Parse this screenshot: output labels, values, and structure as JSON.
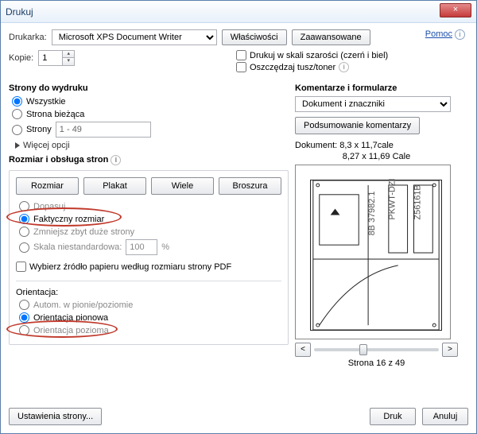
{
  "window": {
    "title": "Drukuj",
    "close": "×"
  },
  "help": {
    "label": "Pomoc"
  },
  "printer": {
    "label": "Drukarka:",
    "value": "Microsoft XPS Document Writer",
    "properties_btn": "Właściwości",
    "advanced_btn": "Zaawansowane"
  },
  "copies": {
    "label": "Kopie:",
    "value": "1"
  },
  "options": {
    "grayscale": "Drukuj w skali szarości (czerń i biel)",
    "save_ink": "Oszczędzaj tusz/toner"
  },
  "pages": {
    "title": "Strony do wydruku",
    "all": "Wszystkie",
    "current": "Strona bieżąca",
    "range_label": "Strony",
    "range_value": "1 - 49",
    "more": "Więcej opcji"
  },
  "size": {
    "title": "Rozmiar i obsługa stron",
    "btn_size": "Rozmiar",
    "btn_poster": "Plakat",
    "btn_multi": "Wiele",
    "btn_booklet": "Broszura",
    "fit": "Dopasuj",
    "actual": "Faktyczny rozmiar",
    "shrink": "Zmniejsz zbyt duże strony",
    "custom_label": "Skala niestandardowa:",
    "custom_value": "100",
    "percent": "%",
    "paper_source": "Wybierz źródło papieru według rozmiaru strony PDF"
  },
  "orientation": {
    "title": "Orientacja:",
    "auto": "Autom. w pionie/poziomie",
    "portrait": "Orientacja pionowa",
    "landscape": "Orientacja pozioma"
  },
  "comments": {
    "title": "Komentarze i formularze",
    "value": "Dokument i znaczniki",
    "summary_btn": "Podsumowanie komentarzy"
  },
  "preview": {
    "doc_size": "Dokument: 8,3 x 11,7cale",
    "page_size": "8,27 x 11,69 Cale",
    "page_of": "Strona 16 z 49"
  },
  "footer": {
    "page_setup": "Ustawienia strony...",
    "print": "Druk",
    "cancel": "Anuluj"
  }
}
